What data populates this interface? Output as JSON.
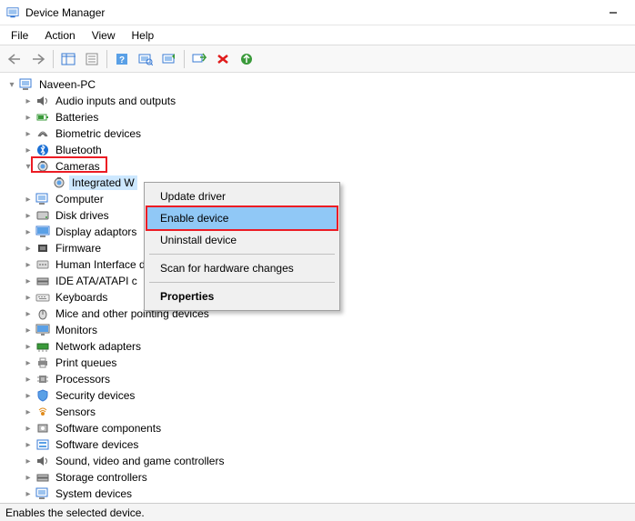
{
  "window": {
    "title": "Device Manager"
  },
  "menu": {
    "file": "File",
    "action": "Action",
    "view": "View",
    "help": "Help"
  },
  "tree": {
    "root": "Naveen-PC",
    "categories": [
      "Audio inputs and outputs",
      "Batteries",
      "Biometric devices",
      "Bluetooth",
      "Cameras",
      "Computer",
      "Disk drives",
      "Display adaptors",
      "Firmware",
      "Human Interface d",
      "IDE ATA/ATAPI c",
      "Keyboards",
      "Mice and other pointing devices",
      "Monitors",
      "Network adapters",
      "Print queues",
      "Processors",
      "Security devices",
      "Sensors",
      "Software components",
      "Software devices",
      "Sound, video and game controllers",
      "Storage controllers",
      "System devices"
    ],
    "camera_child": "Integrated W"
  },
  "context_menu": {
    "update": "Update driver",
    "enable": "Enable device",
    "uninstall": "Uninstall device",
    "scan": "Scan for hardware changes",
    "properties": "Properties"
  },
  "statusbar": {
    "text": "Enables the selected device."
  }
}
